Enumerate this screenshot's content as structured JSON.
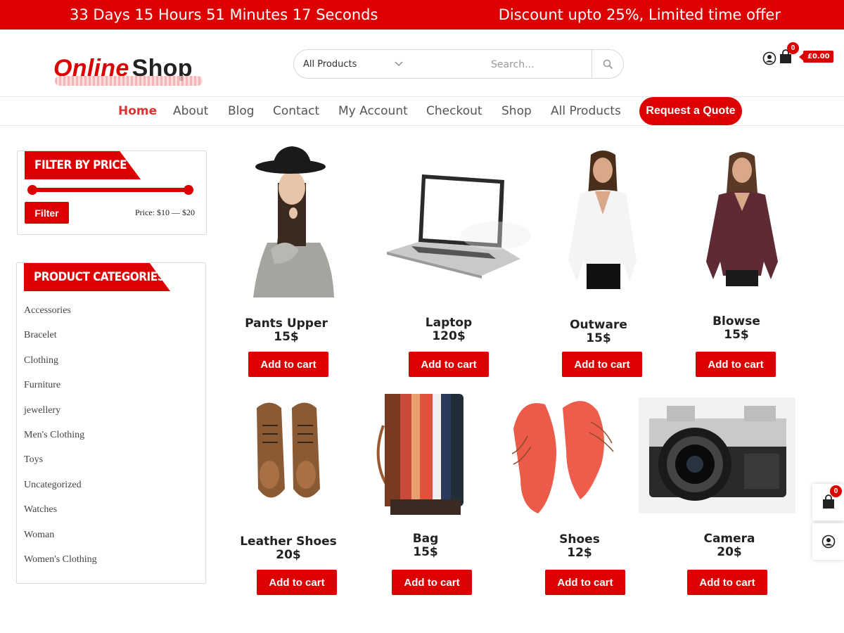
{
  "topbar": {
    "countdown": "33 Days 15 Hours 51 Minutes 17 Seconds",
    "offer": "Discount upto 25%, Limited time offer"
  },
  "header": {
    "logo_part1": "Online",
    "logo_part2": "Shop",
    "search_category": "All Products",
    "search_placeholder": "Search...",
    "cart_count": "0",
    "cart_total": "£0.00"
  },
  "nav": {
    "items": [
      {
        "label": "Home",
        "active": true
      },
      {
        "label": "About"
      },
      {
        "label": "Blog"
      },
      {
        "label": "Contact"
      },
      {
        "label": "My Account"
      },
      {
        "label": "Checkout"
      },
      {
        "label": "Shop"
      },
      {
        "label": "All Products"
      }
    ],
    "cta": "Request a Quote"
  },
  "sidebar": {
    "price_filter": {
      "title": "FILTER BY PRICE",
      "button": "Filter",
      "range_label": "Price: $10 — $20"
    },
    "categories": {
      "title": "PRODUCT CATEGORIES",
      "items": [
        "Accessories",
        "Bracelet",
        "Clothing",
        "Furniture",
        "jewellery",
        "Men's Clothing",
        "Toys",
        "Uncategorized",
        "Watches",
        "Woman",
        "Women's Clothing"
      ]
    }
  },
  "products": [
    {
      "name": "Pants Upper",
      "price": "15$",
      "button": "Add to cart",
      "image": "woman-black-hat-photo"
    },
    {
      "name": "Laptop",
      "price": "120$",
      "button": "Add to cart",
      "image": "laptop-photo"
    },
    {
      "name": "Outware",
      "price": "15$",
      "button": "Add to cart",
      "image": "white-blouse-model-photo"
    },
    {
      "name": "Blowse",
      "price": "15$",
      "button": "Add to cart",
      "image": "maroon-top-model-photo"
    },
    {
      "name": "Leather Shoes",
      "price": "20$",
      "button": "Add to cart",
      "image": "brown-leather-shoes-photo"
    },
    {
      "name": "Bag",
      "price": "15$",
      "button": "Add to cart",
      "image": "striped-wallet-photo"
    },
    {
      "name": "Shoes",
      "price": "12$",
      "button": "Add to cart",
      "image": "red-shoes-photo"
    },
    {
      "name": "Camera",
      "price": "20$",
      "button": "Add to cart",
      "image": "vintage-camera-photo"
    }
  ],
  "floating": {
    "cart_count": "0"
  },
  "colors": {
    "accent": "#dd0000",
    "nav_active": "#dd3333"
  }
}
